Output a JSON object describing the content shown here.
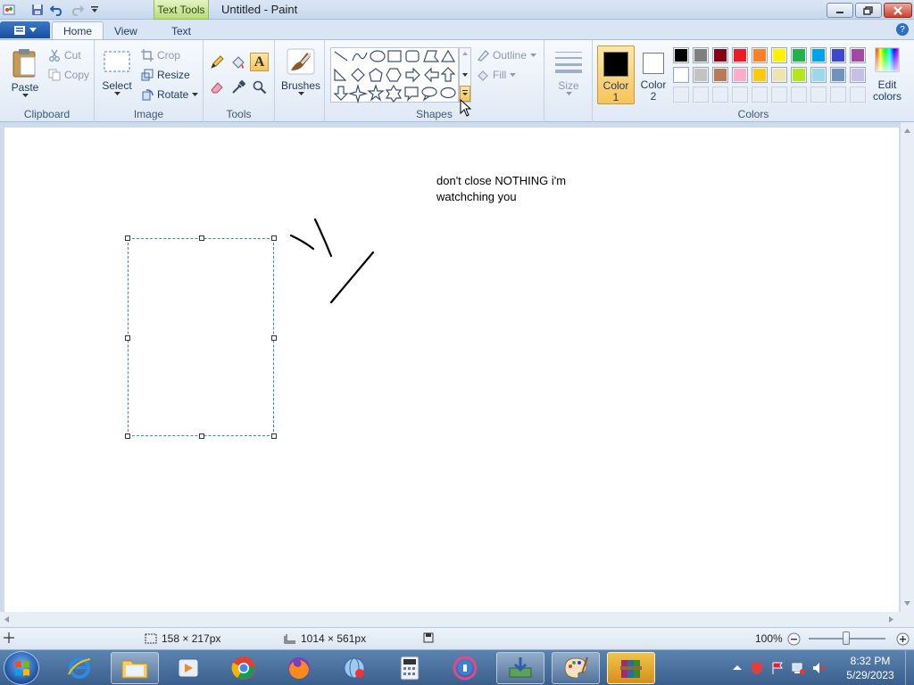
{
  "window": {
    "title": "Untitled - Paint",
    "contextual_tab": "Text Tools"
  },
  "tabs": [
    {
      "label": "Home",
      "active": true
    },
    {
      "label": "View",
      "active": false
    },
    {
      "label": "Text",
      "active": false
    }
  ],
  "ribbon": {
    "clipboard": {
      "label": "Clipboard",
      "paste": "Paste",
      "cut": "Cut",
      "copy": "Copy"
    },
    "image": {
      "label": "Image",
      "select": "Select",
      "crop": "Crop",
      "resize": "Resize",
      "rotate": "Rotate"
    },
    "tools": {
      "label": "Tools"
    },
    "brushes": {
      "label": "Brushes"
    },
    "shapes": {
      "label": "Shapes",
      "outline": "Outline",
      "fill": "Fill"
    },
    "size": {
      "label": "Size"
    },
    "colors": {
      "label": "Colors",
      "color1": {
        "line1": "Color",
        "line2": "1",
        "value": "#000000"
      },
      "color2": {
        "line1": "Color",
        "line2": "2",
        "value": "#ffffff"
      },
      "edit": {
        "line1": "Edit",
        "line2": "colors"
      },
      "palette_row1": [
        "#000000",
        "#7f7f7f",
        "#880015",
        "#ed1c24",
        "#ff7f27",
        "#fff200",
        "#22b14c",
        "#00a2e8",
        "#3f48cc",
        "#a349a4"
      ],
      "palette_row2": [
        "#ffffff",
        "#c3c3c3",
        "#b97a57",
        "#ffaec9",
        "#ffc90e",
        "#efe4b0",
        "#b5e61d",
        "#99d9ea",
        "#7092be",
        "#c8bfe7"
      ]
    }
  },
  "canvas": {
    "text_line1": "don't close NOTHING i'm",
    "text_line2": "watchching you"
  },
  "status": {
    "selection_size": "158 × 217px",
    "image_size": "1014 × 561px",
    "zoom": "100%"
  },
  "taskbar": {
    "time": "8:32 PM",
    "date": "5/29/2023"
  }
}
